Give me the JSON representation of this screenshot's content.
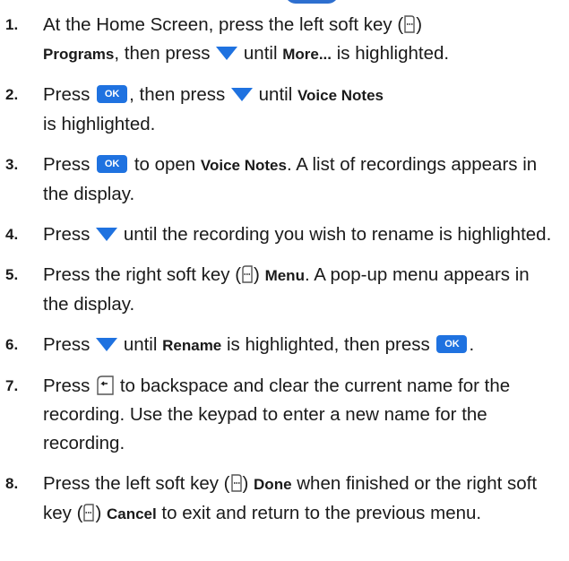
{
  "steps": [
    {
      "num": "1.",
      "t1": "At the Home Screen, press the left soft key (",
      "t2": ")",
      "b1": "Programs",
      "t3": ", then press",
      "t4": "until",
      "b2": "More...",
      "t5": "is highlighted."
    },
    {
      "num": "2.",
      "t1": "Press",
      "ok": "OK",
      "t2": ", then press",
      "t3": "until",
      "b1": "Voice Notes",
      "t4": "is highlighted."
    },
    {
      "num": "3.",
      "t1": "Press",
      "ok": "OK",
      "t2": "to open",
      "b1": "Voice Notes",
      "t3": ". A list of recordings appears in the display."
    },
    {
      "num": "4.",
      "t1": "Press",
      "t2": "until the recording you wish to rename is highlighted."
    },
    {
      "num": "5.",
      "t1": "Press the right soft key (",
      "t2": ")",
      "b1": "Menu",
      "t3": ". A pop-up menu appears in the display."
    },
    {
      "num": "6.",
      "t1": "Press",
      "t2": "until",
      "b1": "Rename",
      "t3": "is highlighted, then press",
      "ok": "OK",
      "t4": "."
    },
    {
      "num": "7.",
      "t1": "Press",
      "t2": "to backspace and clear the current name for the recording. Use the keypad to enter a new name for the recording."
    },
    {
      "num": "8.",
      "t1": "Press the left soft key (",
      "t2": ")",
      "b1": "Done",
      "t3": "when finished or the right soft key (",
      "t4": ")",
      "b2": "Cancel",
      "t5": "to exit and return to the previous menu."
    }
  ],
  "icons": {
    "down_arrow_color": "#1f72e0",
    "ok_button_color": "#1f72e0"
  }
}
